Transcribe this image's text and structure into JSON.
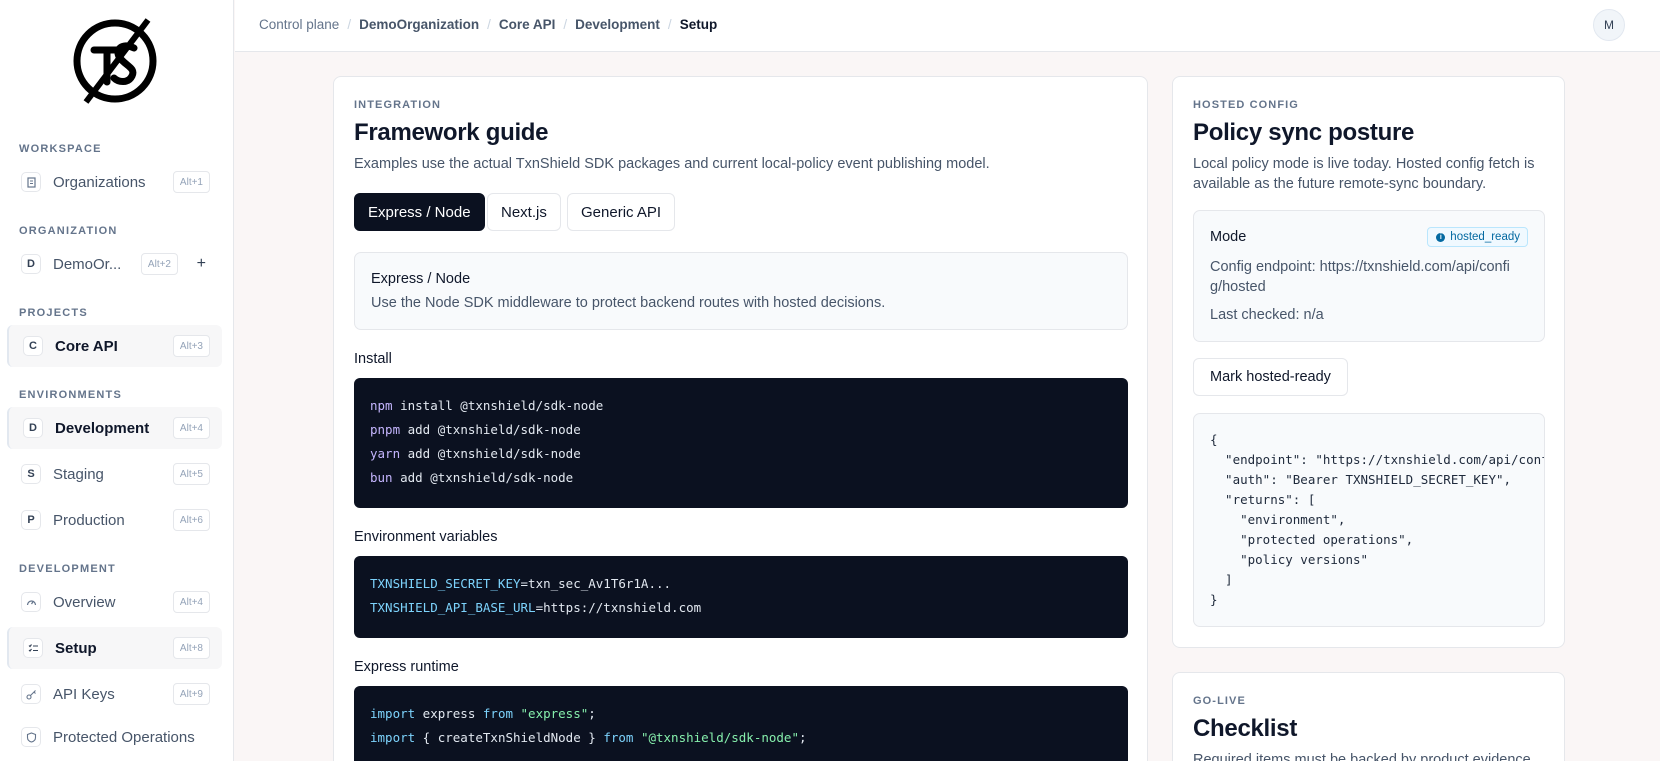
{
  "sidebar": {
    "sections": {
      "workspace": "WORKSPACE",
      "organization": "ORGANIZATION",
      "projects": "PROJECTS",
      "environments": "ENVIRONMENTS",
      "development": "DEVELOPMENT"
    },
    "items": {
      "organizations": {
        "label": "Organizations",
        "kbd": "Alt+1"
      },
      "demo_org": {
        "badge": "D",
        "label": "DemoOr...",
        "kbd": "Alt+2",
        "plus": "+"
      },
      "core_api": {
        "badge": "C",
        "label": "Core API",
        "kbd": "Alt+3"
      },
      "development": {
        "badge": "D",
        "label": "Development",
        "kbd": "Alt+4"
      },
      "staging": {
        "badge": "S",
        "label": "Staging",
        "kbd": "Alt+5"
      },
      "production": {
        "badge": "P",
        "label": "Production",
        "kbd": "Alt+6"
      },
      "overview": {
        "label": "Overview",
        "kbd": "Alt+4"
      },
      "setup": {
        "label": "Setup",
        "kbd": "Alt+8"
      },
      "api_keys": {
        "label": "API Keys",
        "kbd": "Alt+9"
      },
      "protected_ops": {
        "label": "Protected Operations"
      }
    }
  },
  "breadcrumb": {
    "control_plane": "Control plane",
    "org": "DemoOrganization",
    "project": "Core API",
    "env": "Development",
    "current": "Setup",
    "sep": "/"
  },
  "user": {
    "initial": "M"
  },
  "guide": {
    "eyebrow": "INTEGRATION",
    "title": "Framework guide",
    "desc": "Examples use the actual TxnShield SDK packages and current local-policy event publishing model.",
    "tabs": [
      "Express / Node",
      "Next.js",
      "Generic API"
    ],
    "info_title": "Express / Node",
    "info_desc": "Use the Node SDK middleware to protect backend routes with hosted decisions.",
    "install_heading": "Install",
    "install_lines": [
      {
        "cmd": "npm",
        "rest": " install @txnshield/sdk-node"
      },
      {
        "cmd": "pnpm",
        "rest": " add @txnshield/sdk-node"
      },
      {
        "cmd": "yarn",
        "rest": " add @txnshield/sdk-node"
      },
      {
        "cmd": "bun",
        "rest": " add @txnshield/sdk-node"
      }
    ],
    "env_heading": "Environment variables",
    "env_lines": [
      {
        "key": "TXNSHIELD_SECRET_KEY",
        "val": "=txn_sec_Av1T6r1A..."
      },
      {
        "key": "TXNSHIELD_API_BASE_URL",
        "val": "=https://txnshield.com"
      }
    ],
    "runtime_heading": "Express runtime",
    "runtime_lines": [
      {
        "a": "import",
        "b": " express ",
        "c": "from",
        "d": " \"express\"",
        "e": ";"
      },
      {
        "a": "import",
        "b": " { createTxnShieldNode } ",
        "c": "from",
        "d": " \"@txnshield/sdk-node\"",
        "e": ";"
      }
    ]
  },
  "hosted": {
    "eyebrow": "HOSTED CONFIG",
    "title": "Policy sync posture",
    "desc": "Local policy mode is live today. Hosted config fetch is available as the future remote-sync boundary.",
    "mode_label": "Mode",
    "mode_badge": "hosted_ready",
    "endpoint_text": "Config endpoint: https://txnshield.com/api/confi",
    "endpoint_text2": "g/hosted",
    "last_checked": "Last checked: n/a",
    "mark_button": "Mark hosted-ready",
    "json_lines": [
      "{",
      "  \"endpoint\": \"https://txnshield.com/api/config/hosted\",",
      "  \"auth\": \"Bearer TXNSHIELD_SECRET_KEY\",",
      "  \"returns\": [",
      "    \"environment\",",
      "    \"protected operations\",",
      "    \"policy versions\"",
      "  ]",
      "}"
    ]
  },
  "golive": {
    "eyebrow": "GO-LIVE",
    "title": "Checklist",
    "desc": "Required items must be backed by product evidence."
  },
  "colors": {
    "accent": "#0b1120",
    "badge": "#0369a1"
  }
}
